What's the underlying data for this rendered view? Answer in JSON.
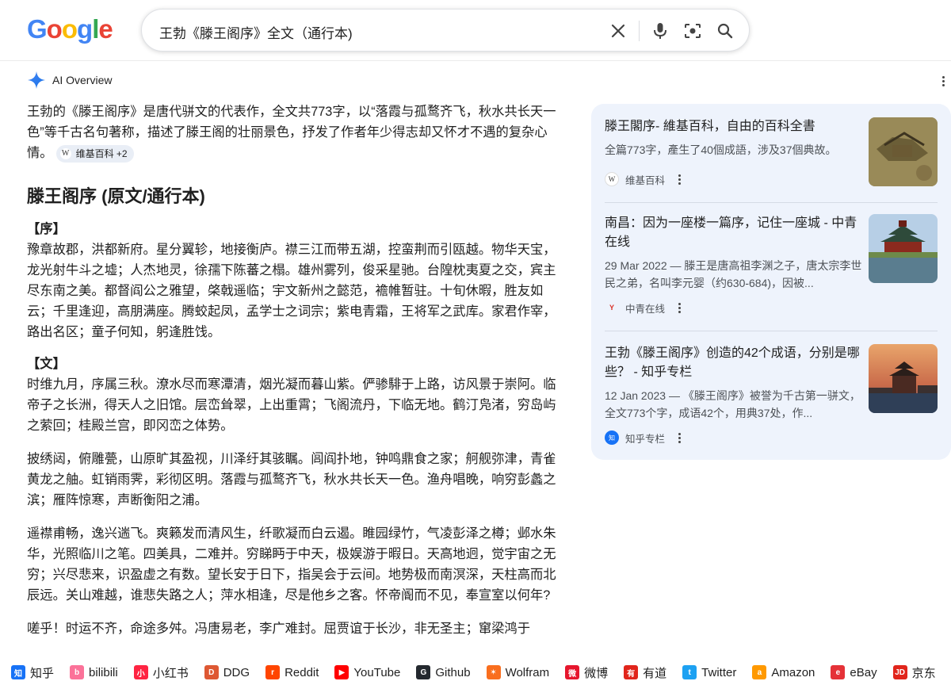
{
  "search": {
    "query": "王勃《滕王阁序》全文（通行本)"
  },
  "logo": {
    "letters": [
      "G",
      "o",
      "o",
      "g",
      "l",
      "e"
    ],
    "colors": [
      "#4285F4",
      "#EA4335",
      "#FBBC05",
      "#4285F4",
      "#34A853",
      "#EA4335"
    ]
  },
  "ai_overview": {
    "label": "AI Overview",
    "summary": "王勃的《滕王阁序》是唐代骈文的代表作，全文共773字，以“落霞与孤鹜齐飞，秋水共长天一色”等千古名句著称，描述了滕王阁的壮丽景色，抒发了作者年少得志却又怀才不遇的复杂心情。",
    "source_chip": "维基百科 +2",
    "heading": "滕王阁序 (原文/通行本)",
    "sections": [
      {
        "label": "【序】",
        "paragraphs": [
          "豫章故郡，洪都新府。星分翼轸，地接衡庐。襟三江而带五湖，控蛮荆而引瓯越。物华天宝，龙光射牛斗之墟；人杰地灵，徐孺下陈蕃之榻。雄州雾列，俊采星驰。台隍枕夷夏之交，宾主尽东南之美。都督阎公之雅望，棨戟遥临；宇文新州之懿范，襜帷暂驻。十旬休暇，胜友如云；千里逢迎，高朋满座。腾蛟起凤，孟学士之词宗；紫电青霜，王将军之武库。家君作宰，路出名区；童子何知，躬逢胜饯。"
        ]
      },
      {
        "label": "【文】",
        "paragraphs": [
          "时维九月，序属三秋。潦水尽而寒潭清，烟光凝而暮山紫。俨骖騑于上路，访风景于崇阿。临帝子之长洲，得天人之旧馆。层峦耸翠，上出重霄；飞阁流丹，下临无地。鹤汀凫渚，穷岛屿之萦回；桂殿兰宫，即冈峦之体势。",
          "披绣闼，俯雕甍，山原旷其盈视，川泽纡其骇瞩。闾阎扑地，钟鸣鼎食之家；舸舰弥津，青雀黄龙之舳。虹销雨霁，彩彻区明。落霞与孤鹜齐飞，秋水共长天一色。渔舟唱晚，响穷彭蠡之滨；雁阵惊寒，声断衡阳之浦。",
          "遥襟甫畅，逸兴遄飞。爽籁发而清风生，纤歌凝而白云遏。睢园绿竹，气凌彭泽之樽；邺水朱华，光照临川之笔。四美具，二难并。穷睇眄于中天，极娱游于暇日。天高地迥，觉宇宙之无穷；兴尽悲来，识盈虚之有数。望长安于日下，指吴会于云间。地势极而南溟深，天柱高而北辰远。关山难越，谁悲失路之人；萍水相逢，尽是他乡之客。怀帝阍而不见，奉宣室以何年?",
          "嗟乎！时运不齐，命途多舛。冯唐易老，李广难封。屈贾谊于长沙，非无圣主；窜梁鸿于"
        ]
      }
    ]
  },
  "sources": [
    {
      "title": "滕王閣序- 維基百科，自由的百科全書",
      "snippet": "全篇773字，產生了40個成語，涉及37個典故。",
      "site": "维基百科",
      "icon": "wikipedia-icon"
    },
    {
      "title": "南昌：因为一座楼一篇序，记住一座城 - 中青在线",
      "snippet": "29 Mar 2022 — 滕王是唐高祖李渊之子，唐太宗李世民之弟，名叫李元婴（约630-684)，因被...",
      "site": "中青在线",
      "icon": "cyol-icon"
    },
    {
      "title": "王勃《滕王阁序》创造的42个成语，分别是哪些？ - 知乎专栏",
      "snippet": "12 Jan 2023 — 《滕王阁序》被誉为千古第一骈文，全文773个字，成语42个，用典37处，作...",
      "site": "知乎专栏",
      "icon": "zhihu-icon"
    }
  ],
  "bookmarks": [
    {
      "label": "知乎",
      "icon_text": "知",
      "color": "#1772F6"
    },
    {
      "label": "bilibili",
      "icon_text": "b",
      "color": "#FB7299"
    },
    {
      "label": "小红书",
      "icon_text": "小",
      "color": "#FF2442"
    },
    {
      "label": "DDG",
      "icon_text": "D",
      "color": "#DE5833"
    },
    {
      "label": "Reddit",
      "icon_text": "r",
      "color": "#FF4500"
    },
    {
      "label": "YouTube",
      "icon_text": "▶",
      "color": "#FF0000"
    },
    {
      "label": "Github",
      "icon_text": "G",
      "color": "#24292F"
    },
    {
      "label": "Wolfram",
      "icon_text": "✶",
      "color": "#F96E1E"
    },
    {
      "label": "微博",
      "icon_text": "微",
      "color": "#E6162D"
    },
    {
      "label": "有道",
      "icon_text": "有",
      "color": "#E1251B"
    },
    {
      "label": "Twitter",
      "icon_text": "t",
      "color": "#1DA1F2"
    },
    {
      "label": "Amazon",
      "icon_text": "a",
      "color": "#FF9900"
    },
    {
      "label": "eBay",
      "icon_text": "e",
      "color": "#E53238"
    },
    {
      "label": "京东",
      "icon_text": "JD",
      "color": "#E1251B"
    }
  ]
}
